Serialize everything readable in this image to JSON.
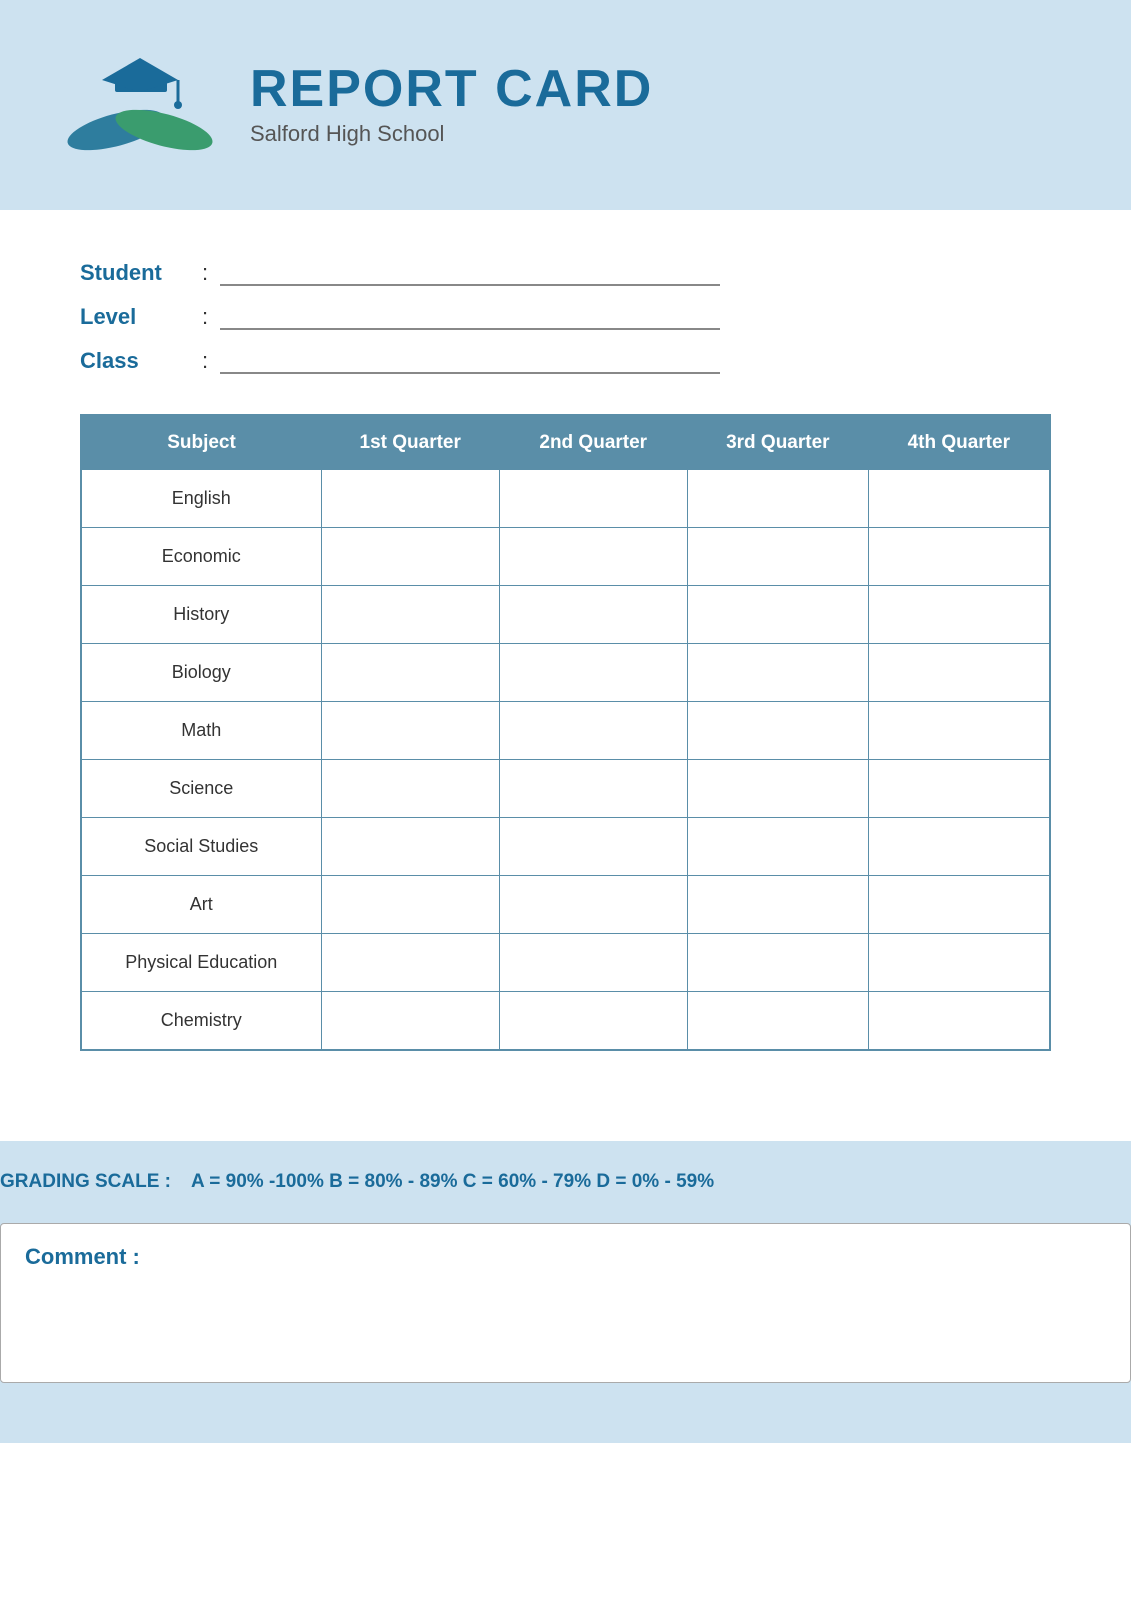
{
  "header": {
    "title": "REPORT CARD",
    "school": "Salford High School"
  },
  "student_info": {
    "student_label": "Student",
    "level_label": "Level",
    "class_label": "Class",
    "colon": ":"
  },
  "table": {
    "headers": [
      "Subject",
      "1st Quarter",
      "2nd Quarter",
      "3rd Quarter",
      "4th Quarter"
    ],
    "rows": [
      {
        "subject": "English"
      },
      {
        "subject": "Economic"
      },
      {
        "subject": "History"
      },
      {
        "subject": "Biology"
      },
      {
        "subject": "Math"
      },
      {
        "subject": "Science"
      },
      {
        "subject": "Social Studies"
      },
      {
        "subject": "Art"
      },
      {
        "subject": "Physical Education"
      },
      {
        "subject": "Chemistry"
      }
    ]
  },
  "grading": {
    "label": "GRADING SCALE :",
    "scale": "A = 90% -100%  B = 80% - 89%  C = 60% - 79%  D = 0% - 59%"
  },
  "comment": {
    "label": "Comment :"
  }
}
